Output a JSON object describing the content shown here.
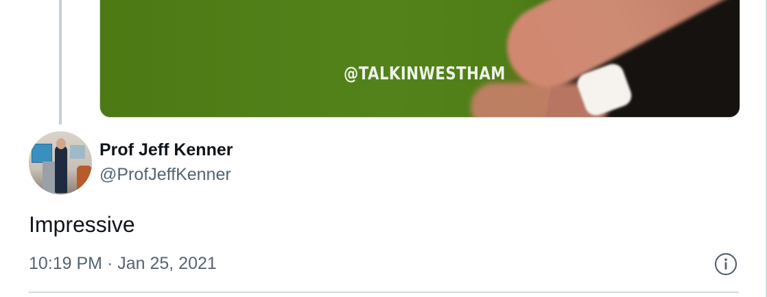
{
  "media": {
    "watermark": "@TALKINWESTHAM"
  },
  "tweet": {
    "author_name": "Prof Jeff Kenner",
    "author_handle": "@ProfJeffKenner",
    "text": "Impressive",
    "timestamp": "10:19 PM · Jan 25, 2021"
  },
  "icons": {
    "info": "info-icon"
  },
  "colors": {
    "text_primary": "#0f1419",
    "text_secondary": "#536471",
    "border": "#cfd9de",
    "media_green": "#4e7a16"
  }
}
